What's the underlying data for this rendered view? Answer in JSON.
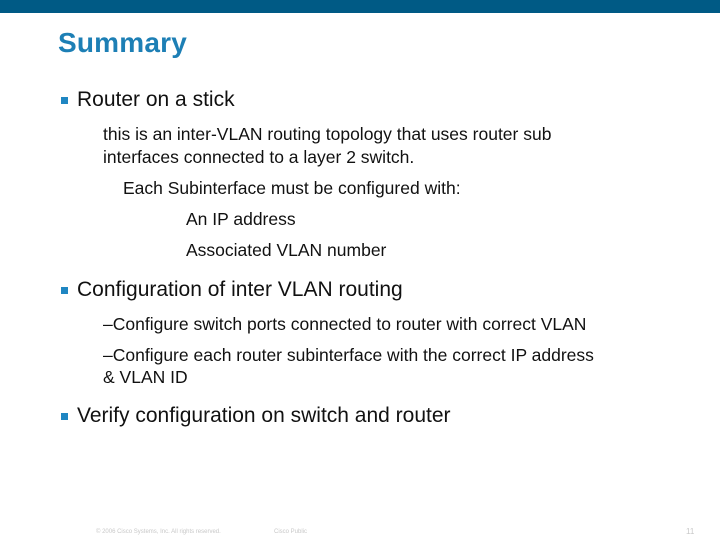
{
  "slide": {
    "title": "Summary",
    "accent_color": "#005a85",
    "title_color": "#1d7fb5",
    "bullets": [
      {
        "text": "Router on a stick",
        "sub": [
          "this is an inter-VLAN routing topology that uses  router sub",
          "interfaces connected to a layer 2 switch.",
          "Each Subinterface must be configured with:",
          "An IP address",
          "Associated VLAN number"
        ]
      },
      {
        "text": "Configuration of inter VLAN routing",
        "sub": [
          "–Configure switch ports connected to router with correct VLAN",
          "–Configure each router subinterface with the correct IP address",
          "& VLAN ID"
        ]
      },
      {
        "text": "Verify configuration on switch and router",
        "sub": []
      }
    ],
    "footer": {
      "copyright": "© 2006 Cisco Systems, Inc. All rights reserved.",
      "classification": "Cisco Public",
      "page_number": "11"
    }
  }
}
